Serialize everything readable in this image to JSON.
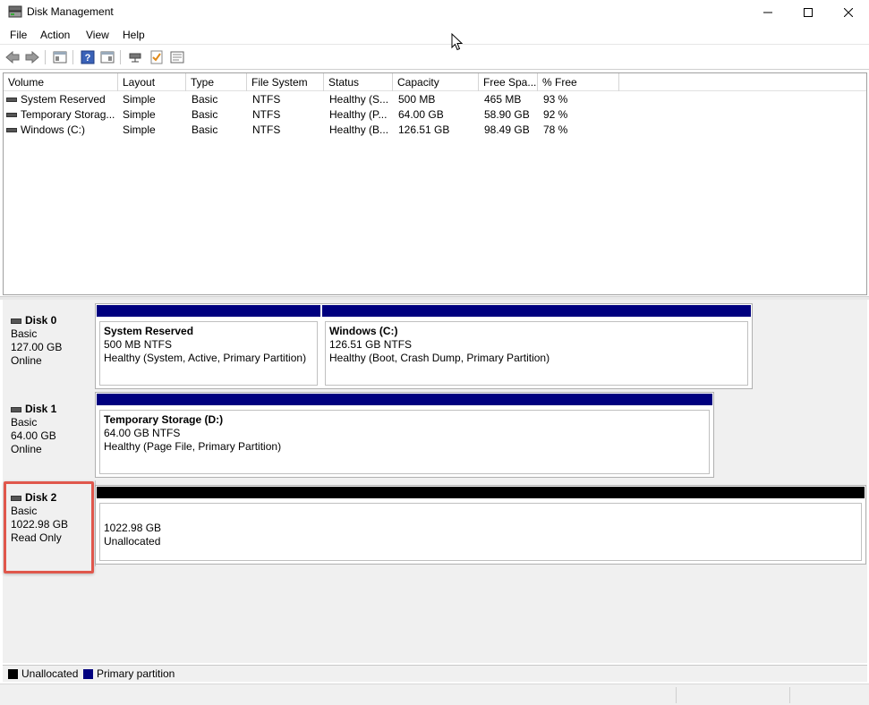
{
  "window": {
    "title": "Disk Management",
    "minimize_icon": "minimize-icon",
    "maximize_icon": "maximize-icon",
    "close_icon": "close-icon"
  },
  "menu": [
    "File",
    "Action",
    "View",
    "Help"
  ],
  "toolbar": {
    "icons": [
      "back-arrow-icon",
      "forward-arrow-icon",
      "console-tree-icon",
      "help-icon",
      "show-hide-icon",
      "connect-icon",
      "check-icon",
      "properties-icon"
    ]
  },
  "volume_table": {
    "columns": [
      "Volume",
      "Layout",
      "Type",
      "File System",
      "Status",
      "Capacity",
      "Free Spa...",
      "% Free"
    ],
    "rows": [
      [
        "System Reserved",
        "Simple",
        "Basic",
        "NTFS",
        "Healthy (S...",
        "500 MB",
        "465 MB",
        "93 %"
      ],
      [
        "Temporary Storag...",
        "Simple",
        "Basic",
        "NTFS",
        "Healthy (P...",
        "64.00 GB",
        "58.90 GB",
        "92 %"
      ],
      [
        "Windows (C:)",
        "Simple",
        "Basic",
        "NTFS",
        "Healthy (B...",
        "126.51 GB",
        "98.49 GB",
        "78 %"
      ]
    ]
  },
  "disks": [
    {
      "name": "Disk 0",
      "type": "Basic",
      "size": "127.00 GB",
      "status": "Online",
      "partitions": [
        {
          "name": "System Reserved",
          "size_fs": "500 MB NTFS",
          "health": "Healthy (System, Active, Primary Partition)",
          "kind": "primary"
        },
        {
          "name": "Windows  (C:)",
          "size_fs": "126.51 GB NTFS",
          "health": "Healthy (Boot, Crash Dump, Primary Partition)",
          "kind": "primary"
        }
      ]
    },
    {
      "name": "Disk 1",
      "type": "Basic",
      "size": "64.00 GB",
      "status": "Online",
      "partitions": [
        {
          "name": "Temporary Storage  (D:)",
          "size_fs": "64.00 GB NTFS",
          "health": "Healthy (Page File, Primary Partition)",
          "kind": "primary"
        }
      ]
    },
    {
      "name": "Disk 2",
      "type": "Basic",
      "size": "1022.98 GB",
      "status": "Read Only",
      "partitions": [
        {
          "name": "",
          "size_fs": "1022.98 GB",
          "health": "Unallocated",
          "kind": "unallocated"
        }
      ]
    }
  ],
  "legend": [
    {
      "label": "Unallocated",
      "color": "#000000"
    },
    {
      "label": "Primary partition",
      "color": "#00007f"
    }
  ],
  "colors": {
    "primary": "#00007f",
    "unallocated": "#000000",
    "highlight": "#e0574c"
  }
}
